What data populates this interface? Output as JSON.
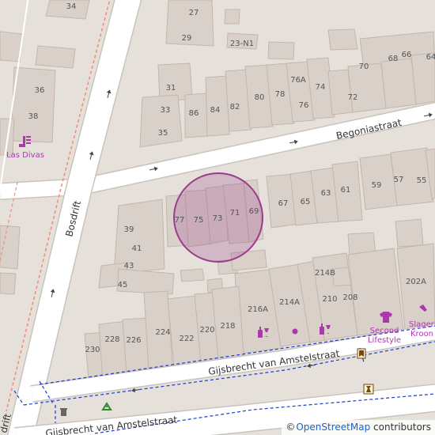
{
  "map": {
    "streets": {
      "begoniastraat": "Begoniastraat",
      "bosdrift": "Bosdrift",
      "gijsbrecht_upper": "Gijsbrecht van Amstelstraat",
      "gijsbrecht_lower": "Gijsbrecht van Amstelstraat",
      "drift_partial": "drift"
    },
    "house_numbers": {
      "n34": "34",
      "n27": "27",
      "n29": "29",
      "n23n1": "23-N1",
      "n36": "36",
      "n38": "38",
      "n31": "31",
      "n33": "33",
      "n35": "35",
      "n86": "86",
      "n84": "84",
      "n82": "82",
      "n80": "80",
      "n78": "78",
      "n76a": "76A",
      "n76": "76",
      "n74": "74",
      "n72": "72",
      "n70": "70",
      "n68": "68",
      "n66": "66",
      "n64": "64",
      "n67": "67",
      "n65": "65",
      "n63": "63",
      "n61": "61",
      "n59": "59",
      "n57": "57",
      "n55": "55",
      "n77": "77",
      "n75": "75",
      "n73": "73",
      "n71": "71",
      "n69": "69",
      "n39": "39",
      "n41": "41",
      "n43": "43",
      "n45": "45",
      "n214b": "214B",
      "n216a": "216A",
      "n214a": "214A",
      "n210": "210",
      "n208": "208",
      "n202a": "202A",
      "n230": "230",
      "n228": "228",
      "n226": "226",
      "n224": "224",
      "n222": "222",
      "n220": "220",
      "n218": "218"
    },
    "pois": {
      "las_divas": "Las Divas",
      "second_line1": "Second",
      "second_line2": "Lifestyle",
      "slager_line1": "Slageri",
      "slager_line2": "Kroon"
    },
    "highlight": {
      "label": "Selected building 73",
      "color": "#9b3c8c"
    },
    "colors": {
      "background": "#e5e1da",
      "building": "#d9d0c9",
      "building_stroke": "#c4b6ab",
      "road": "#ffffff",
      "road_casing": "#c9c3bb",
      "path": "#1a3cd2",
      "poi": "#ac39ac",
      "label": "#333333"
    },
    "attribution": {
      "copy": "©",
      "link": "OpenStreetMap",
      "suffix": " contributors"
    }
  }
}
